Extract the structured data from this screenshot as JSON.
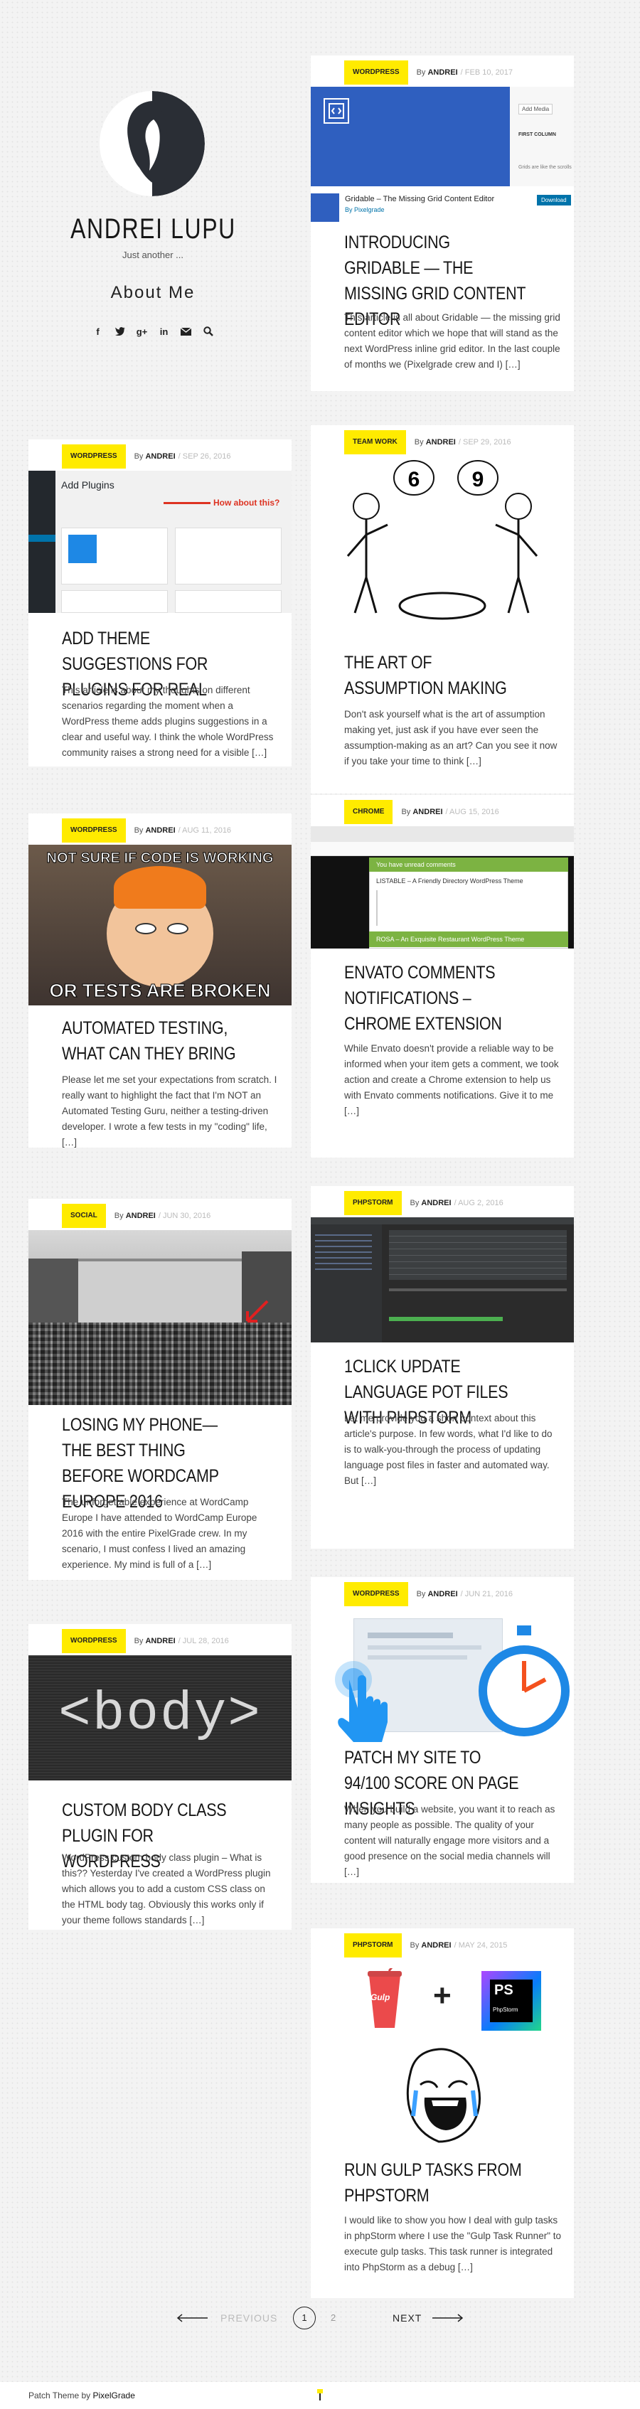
{
  "site": {
    "title": "ANDREI LUPU",
    "tagline": "Just another ...",
    "about_link": "About Me",
    "social_icons": [
      "facebook-icon",
      "twitter-icon",
      "google-plus-icon",
      "linkedin-icon",
      "mail-icon",
      "search-icon"
    ]
  },
  "posts": [
    {
      "category": "WORDPRESS",
      "by": "By",
      "author": "ANDREI",
      "date": "FEB 10, 2017",
      "title": "INTRODUCING GRIDABLE — THE MISSING GRID CONTENT EDITOR",
      "excerpt": "This article is all about Gridable — the missing grid content editor which we hope that will stand as the next WordPress inline grid editor. In the last couple of months we (Pixelgrade crew and I) […]",
      "thumb_caption": "Gridable – The Missing Grid Content Editor",
      "thumb_sub": "By Pixelgrade",
      "thumb_btn": "Download",
      "thumb_add": "Add Media",
      "thumb_col": "FIRST COLUMN",
      "thumb_note": "Grids are like the scrolls"
    },
    {
      "category": "WORDPRESS",
      "by": "By",
      "author": "ANDREI",
      "date": "SEP 26, 2016",
      "title": "ADD THEME SUGGESTIONS FOR PLUGINS FOR REAL",
      "excerpt": "This article is about my thoughts on different scenarios regarding the moment when a WordPress theme adds plugins suggestions in a clear and useful way. I think the whole WordPress community raises a strong need for a visible […]",
      "thumb_heading": "Add Plugins",
      "thumb_callout": "How about this?"
    },
    {
      "category": "TEAM WORK",
      "by": "By",
      "author": "ANDREI",
      "date": "SEP 29, 2016",
      "title": "THE ART OF ASSUMPTION MAKING",
      "excerpt": "Don't ask yourself what is the art of assumption making yet, just ask if you have ever seen the assumption-making as an art? Can you see it now if you take your time to think […]",
      "thumb_left": "6",
      "thumb_right": "9"
    },
    {
      "category": "WORDPRESS",
      "by": "By",
      "author": "ANDREI",
      "date": "AUG 11, 2016",
      "title": "AUTOMATED TESTING, WHAT CAN THEY BRING",
      "excerpt": "Please let me set your expectations from scratch. I really want to highlight the fact that I'm NOT an Automated Testing Guru, neither a testing-driven developer. I wrote a few tests in my \"coding\" life, […]",
      "thumb_top": "NOT SURE IF CODE IS WORKING",
      "thumb_bottom": "OR TESTS ARE BROKEN"
    },
    {
      "category": "CHROME",
      "by": "By",
      "author": "ANDREI",
      "date": "AUG 15, 2016",
      "title": "ENVATO COMMENTS NOTIFICATIONS – CHROME EXTENSION",
      "excerpt": "While Envato doesn't provide a reliable way to be informed when your item gets a comment, we took action and create a Chrome extension to help us with Envato comments notifications. Give it to me […]",
      "thumb_header": "You have unread comments",
      "thumb_item1": "LISTABLE – A Friendly Directory WordPress Theme",
      "thumb_item2": "ROSA – An Exquisite Restaurant WordPress Theme"
    },
    {
      "category": "SOCIAL",
      "by": "By",
      "author": "ANDREI",
      "date": "JUN 30, 2016",
      "title": "LOSING MY PHONE—THE BEST THING BEFORE WORDCAMP EUROPE 2016",
      "excerpt": "The unforgettable experience at WordCamp Europe I have attended to WordCamp Europe 2016 with the entire PixelGrade crew. In my scenario, I must confess I lived an amazing experience. My mind is full of a […]"
    },
    {
      "category": "PHPSTORM",
      "by": "By",
      "author": "ANDREI",
      "date": "AUG 2, 2016",
      "title": "1CLICK UPDATE LANGUAGE POT FILES WITH PHPSTORM",
      "excerpt": "Let me provide you a short context about this article's purpose. In few words, what I'd like to do is to walk-you-through the process of updating language post files in faster and automated way. But […]"
    },
    {
      "category": "WORDPRESS",
      "by": "By",
      "author": "ANDREI",
      "date": "JUN 21, 2016",
      "title": "PATCH MY SITE TO 94/100 SCORE ON PAGE INSIGHTS",
      "excerpt": "When you build a website, you want it to reach as many people as possible. The quality of your content will naturally engage more visitors and a good presence on the social media channels will […]"
    },
    {
      "category": "WORDPRESS",
      "by": "By",
      "author": "ANDREI",
      "date": "JUL 28, 2016",
      "title": "CUSTOM BODY CLASS PLUGIN FOR WORDPRESS",
      "excerpt": "WordPress custom body class plugin – What is this?? Yesterday I've created a WordPress plugin which allows you to add a custom CSS class on the HTML body tag. Obviously this works only if your theme follows standards […]",
      "thumb_text": "<body>"
    },
    {
      "category": "PHPSTORM",
      "by": "By",
      "author": "ANDREI",
      "date": "MAY 24, 2015",
      "title": "RUN GULP TASKS FROM PHPSTORM",
      "excerpt": "I would like to show you how I deal with gulp tasks in phpStorm where I use the \"Gulp Task Runner\" to execute gulp tasks. This task runner is integrated into PhpStorm as a debug […]",
      "thumb_gulp": "Gulp",
      "thumb_plus": "+",
      "thumb_ps": "PhpStorm"
    }
  ],
  "pagination": {
    "previous": "PREVIOUS",
    "current": "1",
    "next_page": "2",
    "next": "NEXT"
  },
  "footer": {
    "text": "Patch Theme by",
    "link": "PixelGrade"
  },
  "colors": {
    "accent": "#ffeb00",
    "text": "#171717"
  }
}
